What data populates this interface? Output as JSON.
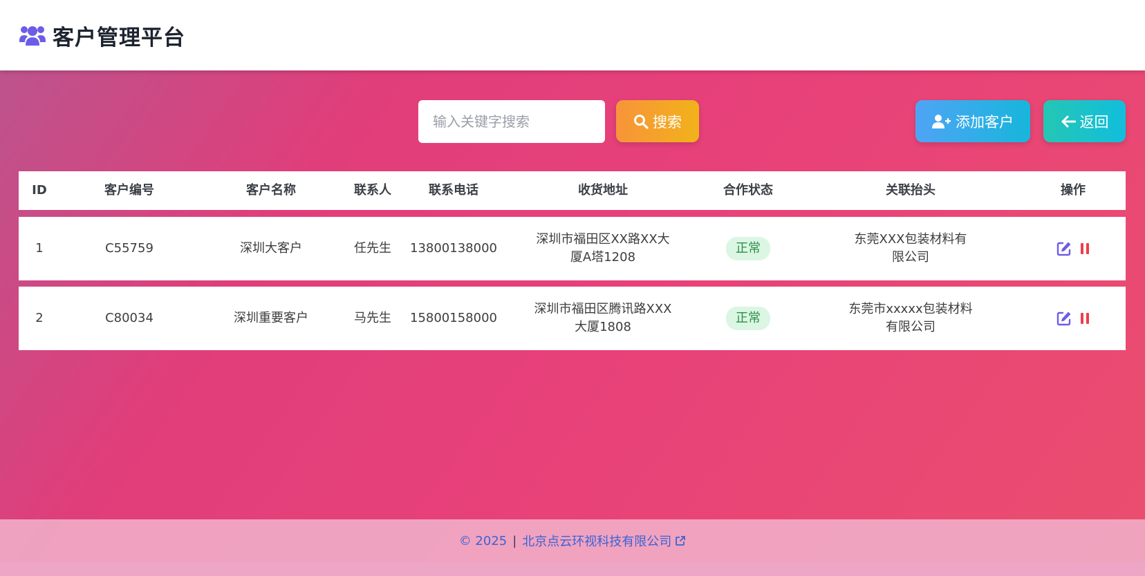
{
  "header": {
    "title": "客户管理平台",
    "icon": "users-icon"
  },
  "toolbar": {
    "search_placeholder": "输入关键字搜索",
    "search_value": "",
    "search_label": "搜索",
    "add_label": "添加客户",
    "back_label": "返回"
  },
  "table": {
    "columns": [
      "ID",
      "客户编号",
      "客户名称",
      "联系人",
      "联系电话",
      "收货地址",
      "合作状态",
      "关联抬头",
      "操作"
    ],
    "rows": [
      {
        "id": "1",
        "code": "C55759",
        "name": "深圳大客户",
        "contact": "任先生",
        "phone": "13800138000",
        "address_line1": "深圳市福田区XX路XX大",
        "address_line2": "厦A塔1208",
        "status": "正常",
        "related_line1": "东莞XXX包装材料有",
        "related_line2": "限公司"
      },
      {
        "id": "2",
        "code": "C80034",
        "name": "深圳重要客户",
        "contact": "马先生",
        "phone": "15800158000",
        "address_line1": "深圳市福田区腾讯路XXX",
        "address_line2": "大厦1808",
        "status": "正常",
        "related_line1": "东莞市xxxxx包装材料",
        "related_line2": "有限公司"
      }
    ]
  },
  "footer": {
    "copyright": "© 2025",
    "separator": "|",
    "company": "北京点云环视科技有限公司"
  },
  "colors": {
    "accent": "#6c5ce7",
    "status_bg": "#dbf6e2",
    "status_text": "#2f8d4a",
    "pause_icon": "#ef3d4a",
    "link": "#3a63d6"
  }
}
